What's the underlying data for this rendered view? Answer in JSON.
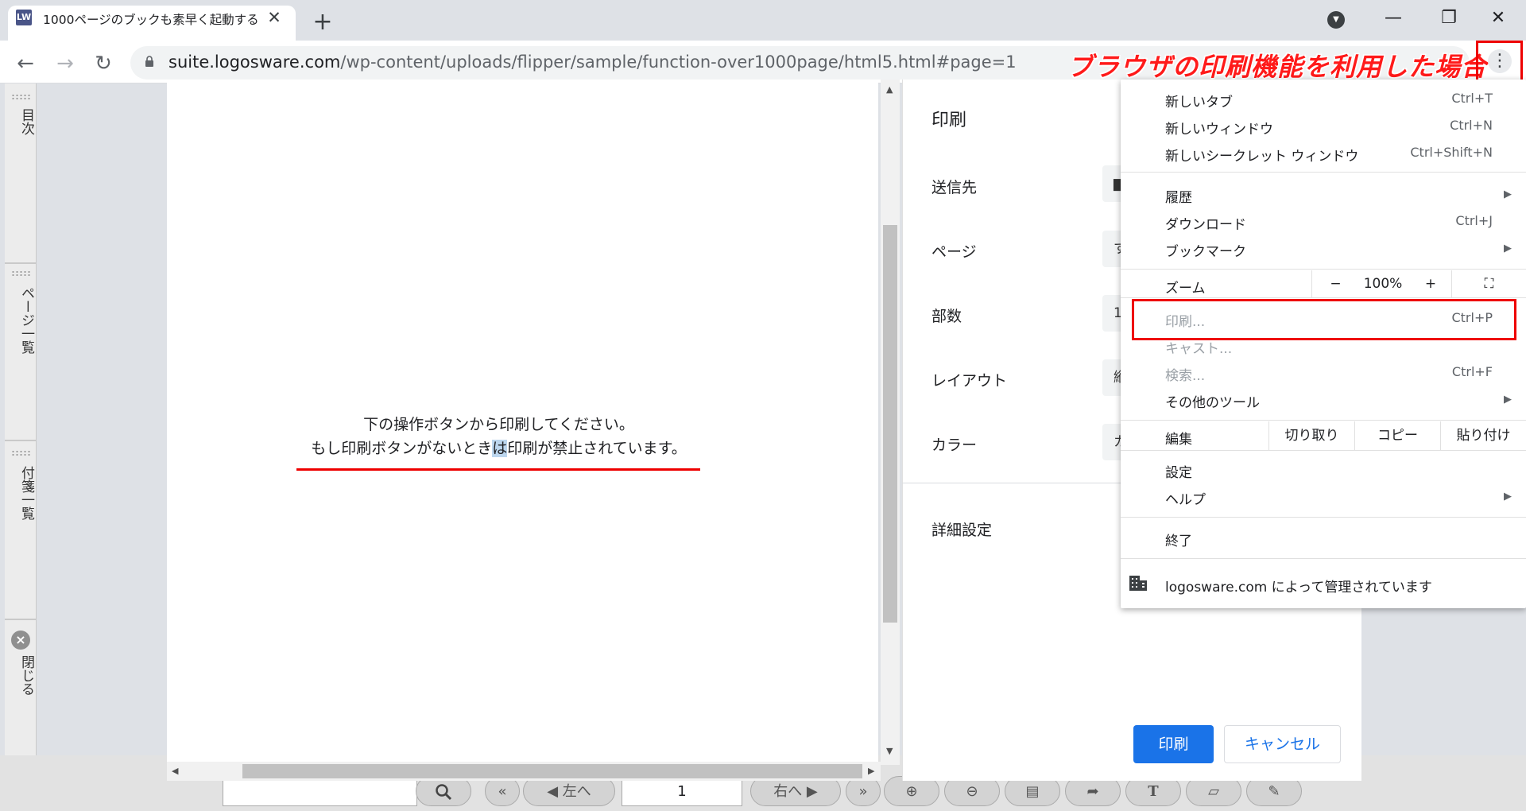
{
  "tab": {
    "title": "1000ページのブックも素早く起動する",
    "close": "✕",
    "new_tab": "+"
  },
  "window": {
    "minimize": "—",
    "maximize": "❐",
    "close": "✕"
  },
  "toolbar": {
    "back": "←",
    "forward": "→",
    "reload": "↻"
  },
  "url": {
    "host": "suite.logosware.com",
    "path": "/wp-content/uploads/flipper/sample/function-over1000page/html5.html#page=1"
  },
  "annotation": "ブラウザの印刷機能を利用した場合",
  "sidebar": {
    "toc": "目次",
    "page_list": "ページ一覧",
    "sticky_list": "付箋一覧",
    "close": "閉じる"
  },
  "preview": {
    "line1": "下の操作ボタンから印刷してください。",
    "line2_a": "もし印刷ボタンがないとき",
    "line2_hl": "は",
    "line2_b": "印刷が禁止されています。"
  },
  "print_panel": {
    "title": "印刷",
    "destination_label": "送信先",
    "pages_label": "ページ",
    "pages_value": "す",
    "copies_label": "部数",
    "copies_value": "1",
    "layout_label": "レイアウト",
    "layout_value": "縦",
    "color_label": "カラー",
    "color_value": "カ",
    "advanced_label": "詳細設定",
    "print_button": "印刷",
    "cancel_button": "キャンセル"
  },
  "bottom_bar": {
    "prev_label": "左へ",
    "page_value": "1",
    "next_label": "右へ"
  },
  "menu": {
    "new_tab": "新しいタブ",
    "new_tab_sc": "Ctrl+T",
    "new_window": "新しいウィンドウ",
    "new_window_sc": "Ctrl+N",
    "incognito": "新しいシークレット ウィンドウ",
    "incognito_sc": "Ctrl+Shift+N",
    "history": "履歴",
    "downloads": "ダウンロード",
    "downloads_sc": "Ctrl+J",
    "bookmarks": "ブックマーク",
    "zoom": "ズーム",
    "zoom_minus": "−",
    "zoom_value": "100%",
    "zoom_plus": "+",
    "print": "印刷...",
    "print_sc": "Ctrl+P",
    "cast": "キャスト...",
    "find": "検索...",
    "find_sc": "Ctrl+F",
    "more_tools": "その他のツール",
    "edit": "編集",
    "cut": "切り取り",
    "copy": "コピー",
    "paste": "貼り付け",
    "settings": "設定",
    "help": "ヘルプ",
    "exit": "終了",
    "managed": "logosware.com によって管理されています"
  }
}
